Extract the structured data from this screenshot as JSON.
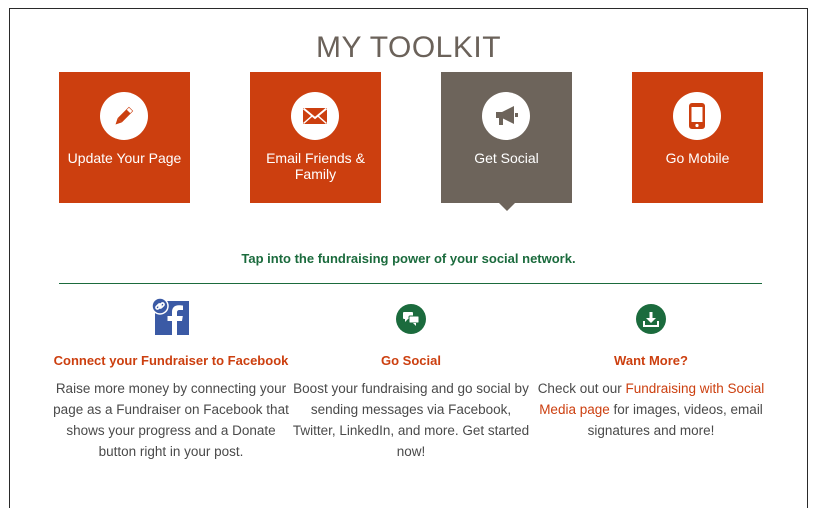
{
  "title": "MY TOOLKIT",
  "tiles": [
    {
      "label": "Update Your Page",
      "icon": "pencil-icon",
      "active": false
    },
    {
      "label": "Email Friends & Family",
      "icon": "envelope-icon",
      "active": false
    },
    {
      "label": "Get Social",
      "icon": "megaphone-icon",
      "active": true
    },
    {
      "label": "Go Mobile",
      "icon": "mobile-phone-icon",
      "active": false
    }
  ],
  "tagline": "Tap into the fundraising power of your social network.",
  "columns": [
    {
      "icon": "facebook-link-icon",
      "heading": "Connect your Fundraiser to Facebook",
      "body": "Raise more money by connecting your page as a Fundraiser on Facebook that shows your progress and a Donate button right in your post."
    },
    {
      "icon": "chat-bubbles-icon",
      "heading": "Go Social",
      "body": "Boost your fundraising and go social by sending messages via Facebook, Twitter, LinkedIn, and more. Get started now!"
    },
    {
      "icon": "download-icon",
      "heading": "Want More?",
      "body_pre": "Check out our ",
      "link": "Fundraising with Social Media page",
      "body_post": " for images, videos, email signatures and more!"
    }
  ],
  "colors": {
    "accent": "#cc3f0f",
    "active_tile": "#6d645b",
    "green": "#1b6b3d",
    "title": "#6b625a"
  }
}
